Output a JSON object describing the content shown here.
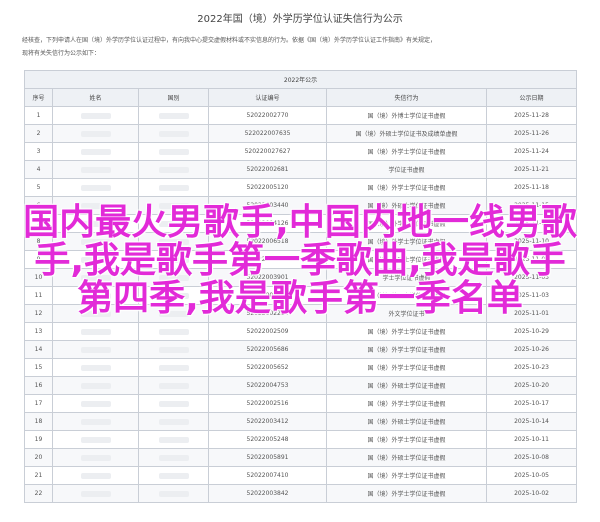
{
  "page": {
    "title": "2022年国（境）外学历学位认证失信行为公示",
    "intro": [
      "经核查，下列申请人在国（境）外学历学位认证过程中，有向我中心提交虚假材料或不实信息的行为。依据《国（境）外学历学位认证工作指南》有关规定，",
      "现将有关失信行为公示如下："
    ]
  },
  "table": {
    "caption": "2022年公示",
    "headers": [
      "序号",
      "姓名",
      "国别",
      "认证编号",
      "失信行为",
      "公示日期"
    ],
    "rows": [
      {
        "no": "1",
        "id": "52022002770",
        "behavior": "国（境）外博士学位证书虚假",
        "date": "2025-11-28"
      },
      {
        "no": "2",
        "id": "522022007635",
        "behavior": "国（境）外硕士学位证书及成绩单虚假",
        "date": "2025-11-26"
      },
      {
        "no": "3",
        "id": "520220027627",
        "behavior": "国（境）外学士学位证书虚假",
        "date": "2025-11-24"
      },
      {
        "no": "4",
        "id": "52022002681",
        "behavior": "学位证书虚假",
        "date": "2025-11-21"
      },
      {
        "no": "5",
        "id": "52022005120",
        "behavior": "国（境）外学士学位证书虚假",
        "date": "2025-11-18"
      },
      {
        "no": "6",
        "id": "52022003440",
        "behavior": "国（境）外硕士学位证书虚假",
        "date": "2025-11-15"
      },
      {
        "no": "7",
        "id": "52022004126",
        "behavior": "国（境）外学士学位证书虚假",
        "date": "2025-11-12"
      },
      {
        "no": "8",
        "id": "52022006518",
        "behavior": "国（境）外学士学位证书虚假",
        "date": "2025-11-10"
      },
      {
        "no": "9",
        "id": "52022006210",
        "behavior": "国（境）外硕士学位证书虚假",
        "date": "2025-11-08"
      },
      {
        "no": "10",
        "id": "52022003901",
        "behavior": "学士学位证书虚假",
        "date": "2025-11-05"
      },
      {
        "no": "11",
        "id": "52022007712",
        "behavior": "国（境）外硕士学位证书虚假",
        "date": "2025-11-03"
      },
      {
        "no": "12",
        "id": "52022002214",
        "behavior": "外文学位证书",
        "date": "2025-11-01"
      },
      {
        "no": "13",
        "id": "52022002509",
        "behavior": "国（境）外学士学位证书虚假",
        "date": "2025-10-29"
      },
      {
        "no": "14",
        "id": "52022005686",
        "behavior": "国（境）外学士学位证书虚假",
        "date": "2025-10-26"
      },
      {
        "no": "15",
        "id": "52022005652",
        "behavior": "国（境）外学士学位证书虚假",
        "date": "2025-10-23"
      },
      {
        "no": "16",
        "id": "52022004753",
        "behavior": "国（境）外硕士学位证书虚假",
        "date": "2025-10-20"
      },
      {
        "no": "17",
        "id": "52022002516",
        "behavior": "国（境）外学士学位证书虚假",
        "date": "2025-10-17"
      },
      {
        "no": "18",
        "id": "52022003412",
        "behavior": "国（境）外硕士学位证书虚假",
        "date": "2025-10-14"
      },
      {
        "no": "19",
        "id": "52022005248",
        "behavior": "国（境）外学士学位证书虚假",
        "date": "2025-10-11"
      },
      {
        "no": "20",
        "id": "52022005891",
        "behavior": "国（境）外硕士学位证书虚假",
        "date": "2025-10-08"
      },
      {
        "no": "21",
        "id": "52022007410",
        "behavior": "国（境）外学士学位证书虚假",
        "date": "2025-10-05"
      },
      {
        "no": "22",
        "id": "52022003842",
        "behavior": "国（境）外学士学位证书虚假",
        "date": "2025-10-02"
      }
    ]
  },
  "overlay": {
    "lines": [
      "国内最火男歌手,中国内地一线男歌",
      "手,我是歌手第一季歌曲,我是歌手",
      "第四季,我是歌手第一季名单"
    ],
    "color": "#e22ad8"
  }
}
